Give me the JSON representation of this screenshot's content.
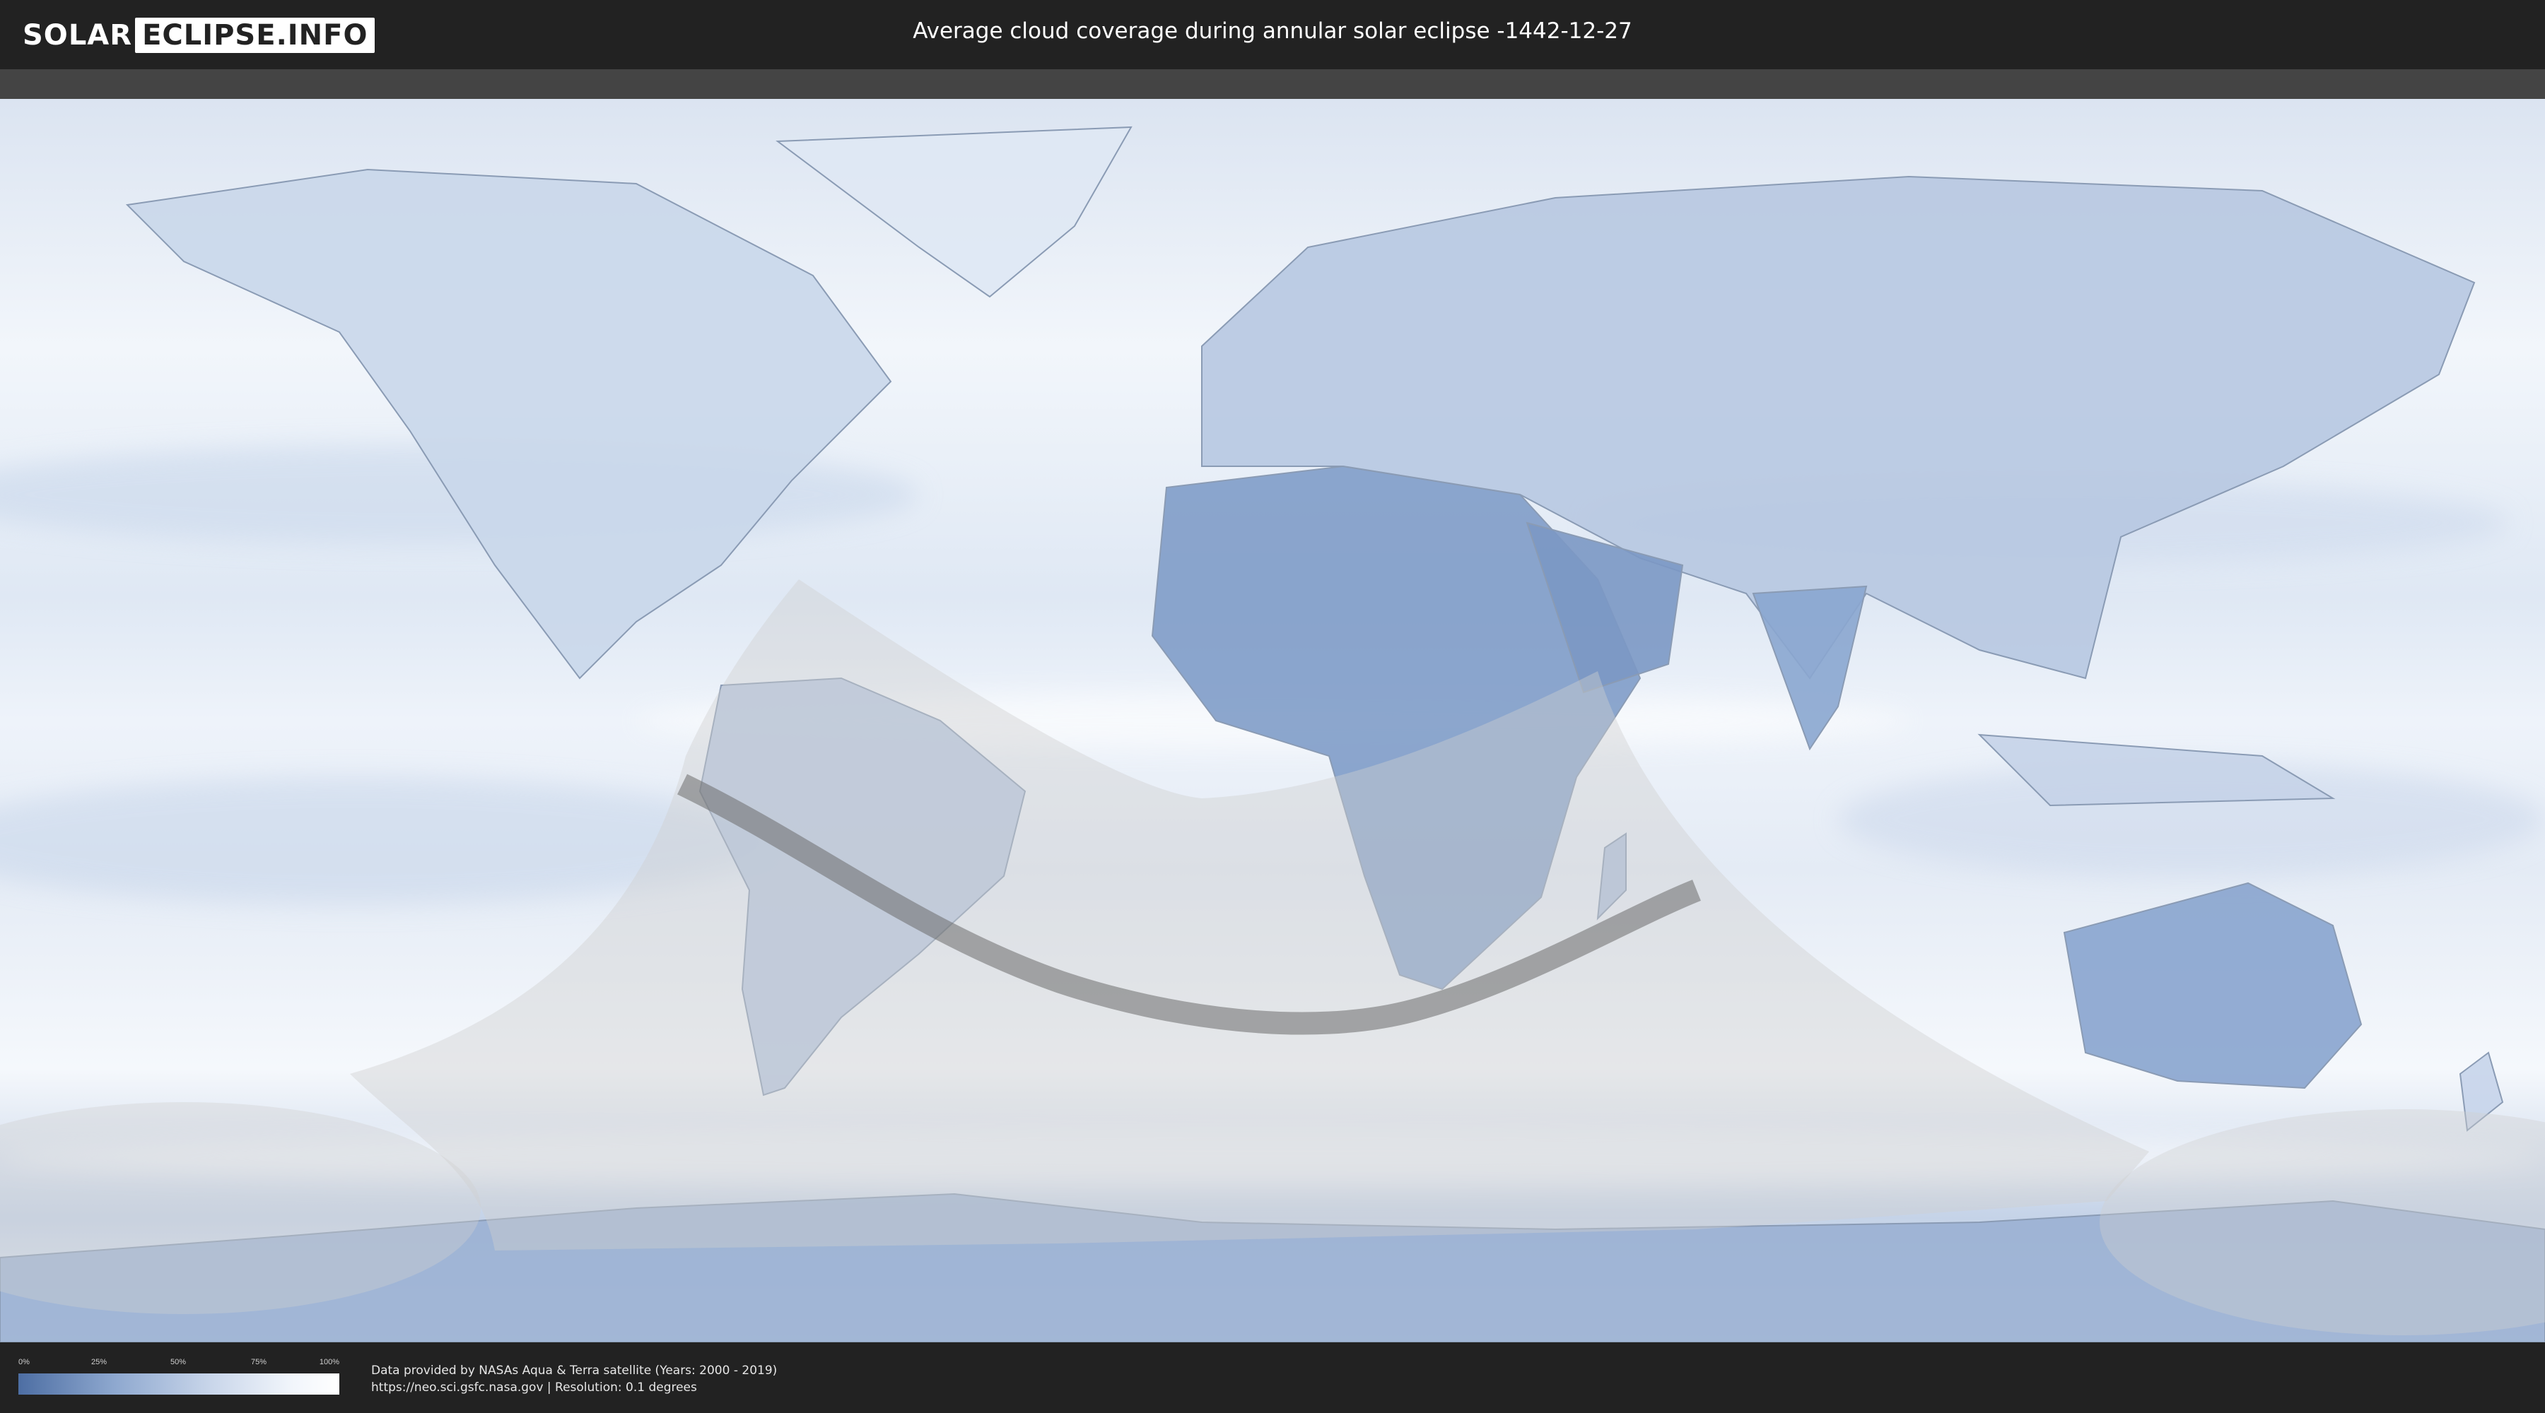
{
  "header": {
    "logo_left": "SOLAR",
    "logo_right": "ECLIPSE.INFO",
    "title": "Average cloud coverage during annular solar eclipse -1442-12-27"
  },
  "legend": {
    "ticks": [
      "0%",
      "25%",
      "50%",
      "75%",
      "100%"
    ],
    "gradient_colors": [
      "#4d6ea3",
      "#8ea8cf",
      "#c9d6ea",
      "#f1f5fb",
      "#ffffff"
    ]
  },
  "credits": {
    "line1": "Data provided by NASAs Aqua & Terra satellite (Years: 2000 - 2019)",
    "line2": "https://neo.sci.gsfc.nasa.gov | Resolution: 0.1 degrees"
  },
  "colors": {
    "background": "#222222",
    "ocean_cloud": "#e8eef7",
    "clear_land": "#6f8ebc",
    "eclipse_shadow": "#c8c8c8",
    "central_path": "#6b6b6b"
  }
}
